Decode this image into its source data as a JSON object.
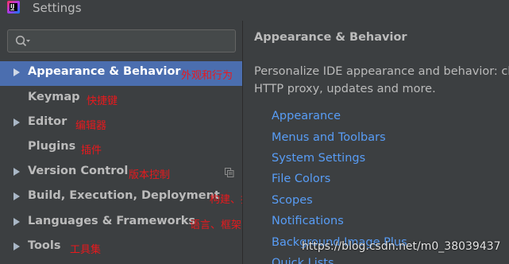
{
  "window": {
    "title": "Settings",
    "app_icon_label": "IJ"
  },
  "search": {
    "placeholder": "",
    "value": ""
  },
  "sidebar": {
    "items": [
      {
        "label": "Appearance & Behavior",
        "note": "外观和行为"
      },
      {
        "label": "Keymap",
        "note": "快捷键"
      },
      {
        "label": "Editor",
        "note": "编辑器"
      },
      {
        "label": "Plugins",
        "note": "插件"
      },
      {
        "label": "Version Control",
        "note": "版本控制"
      },
      {
        "label": "Build, Execution, Deployment",
        "note": "构建、执行、部署"
      },
      {
        "label": "Languages & Frameworks",
        "note": "语言、框架"
      },
      {
        "label": "Tools",
        "note": "工具集"
      }
    ]
  },
  "main": {
    "title": "Appearance & Behavior",
    "description_line1": "Personalize IDE appearance and behavior: ch",
    "description_line2": "HTTP proxy, updates and more.",
    "links": [
      "Appearance",
      "Menus and Toolbars",
      "System Settings",
      "File Colors",
      "Scopes",
      "Notifications",
      "Background Image Plus",
      "Quick Lists"
    ]
  },
  "watermark": "https://blog.csdn.net/m0_38039437",
  "colors": {
    "selection": "#4b6eaf",
    "link": "#589df6",
    "annotation": "#e8191d",
    "background": "#3c3f41"
  }
}
